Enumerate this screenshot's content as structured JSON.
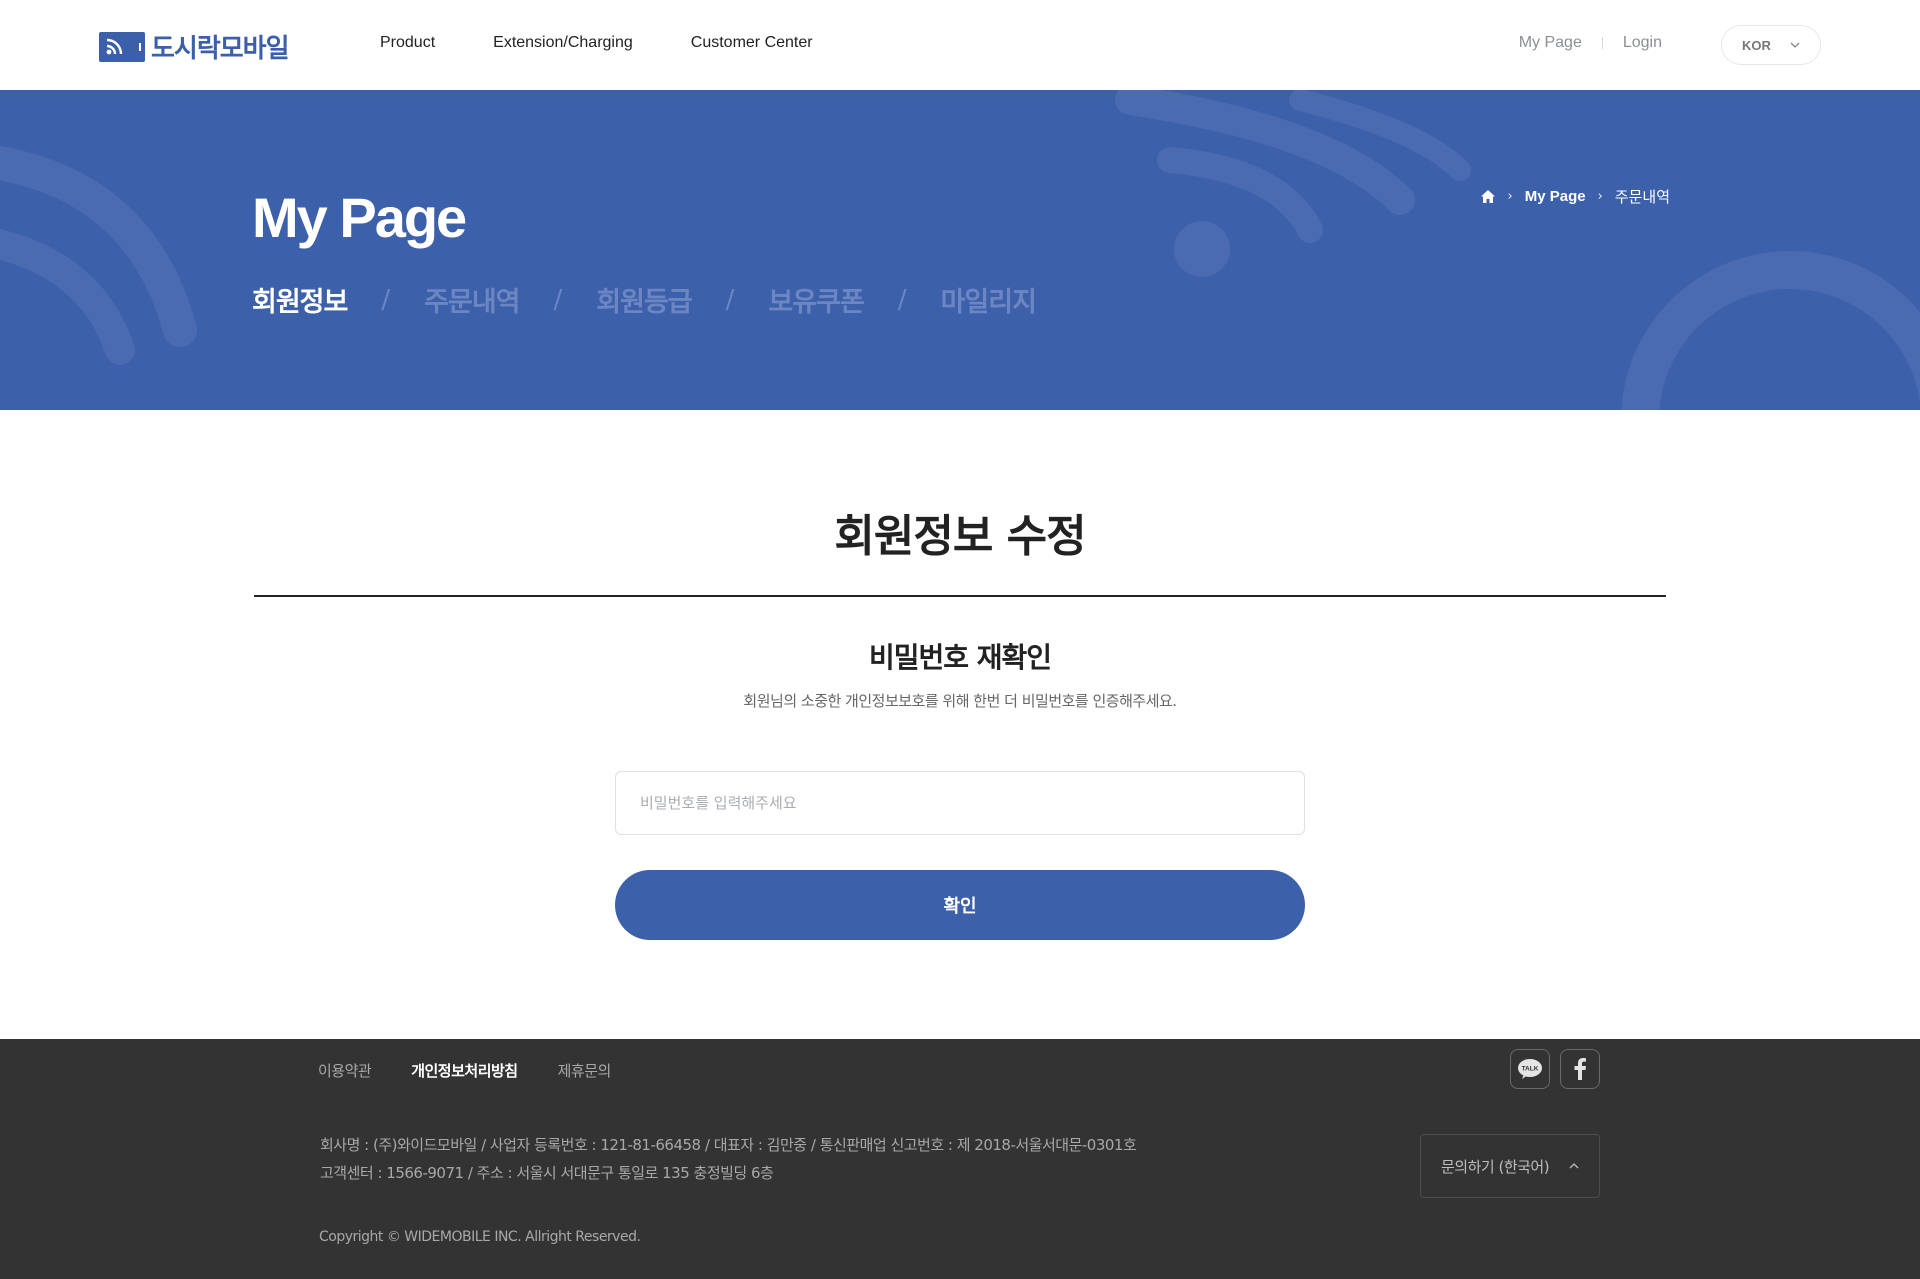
{
  "header": {
    "logo_text": "도시락모바일",
    "nav": [
      "Product",
      "Extension/Charging",
      "Customer Center"
    ],
    "util": {
      "mypage": "My Page",
      "login": "Login"
    },
    "lang": "KOR"
  },
  "hero": {
    "title": "My Page",
    "breadcrumb": [
      "My Page",
      "주문내역"
    ],
    "tabs": [
      "회원정보",
      "주문내역",
      "회원등급",
      "보유쿠폰",
      "마일리지"
    ],
    "active_tab": "회원정보",
    "separator": "/"
  },
  "main": {
    "title": "회원정보 수정",
    "subtitle": "비밀번호 재확인",
    "description": "회원님의 소중한 개인정보보호를 위해 한번 더 비밀번호를 인증해주세요.",
    "password_placeholder": "비밀번호를 입력해주세요",
    "password_value": "",
    "confirm_label": "확인"
  },
  "footer": {
    "links": [
      "이용약관",
      "개인정보처리방침",
      "제휴문의"
    ],
    "info_line1": "회사명 : (주)와이드모바일  /  사업자 등록번호 : 121-81-66458  /  대표자 : 김만중  /  통신판매업 신고번호 : 제 2018-서울서대문-0301호",
    "info_line2": "고객센터 : 1566-9071  /  주소 : 서울시 서대문구 통일로 135 충정빌딩 6층",
    "copyright": "Copyright © WIDEMOBILE INC. Allright Reserved.",
    "inquiry_label": "문의하기 (한국어)",
    "talk_badge": "TALK"
  },
  "colors": {
    "brand": "#3d60ab",
    "footer_bg": "#333333",
    "tab_inactive": "#6b86c2"
  }
}
